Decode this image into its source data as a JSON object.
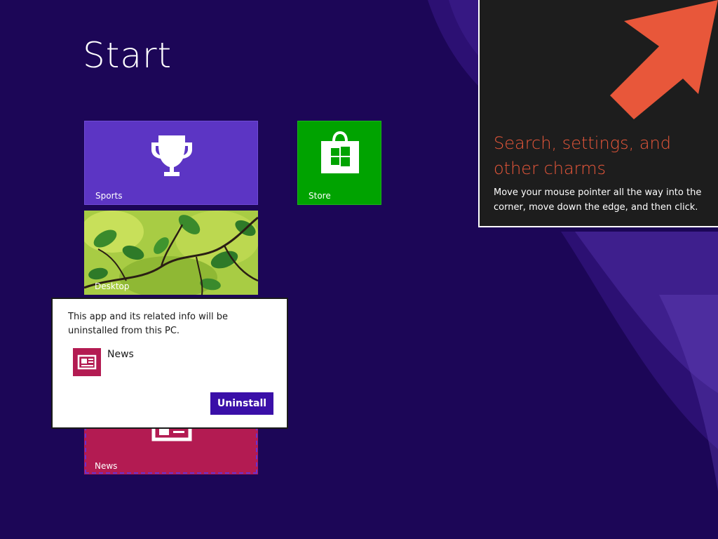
{
  "start": {
    "title": "Start"
  },
  "tiles": [
    {
      "id": "sports",
      "label": "Sports",
      "icon": "trophy-icon",
      "color": "#5c35c4"
    },
    {
      "id": "store",
      "label": "Store",
      "icon": "store-bag-icon",
      "color": "#00a300"
    },
    {
      "id": "desktop",
      "label": "Desktop",
      "icon": "desktop-wallpaper",
      "color": "#9cc43a"
    },
    {
      "id": "news",
      "label": "News",
      "icon": "newspaper-icon",
      "color": "#b31b52"
    }
  ],
  "charms_tip": {
    "heading": "Search, settings, and other charms",
    "body": "Move your mouse pointer all the way into the corner, move down the edge, and then click.",
    "icon": "arrow-up-right-icon",
    "accent_color": "#e8573a"
  },
  "uninstall_dialog": {
    "message": "This app and its related info will be uninstalled from this PC.",
    "app_name": "News",
    "app_icon": "newspaper-icon",
    "button_label": "Uninstall",
    "button_color": "#3a0fa8"
  },
  "colors": {
    "background": "#1c0657"
  }
}
